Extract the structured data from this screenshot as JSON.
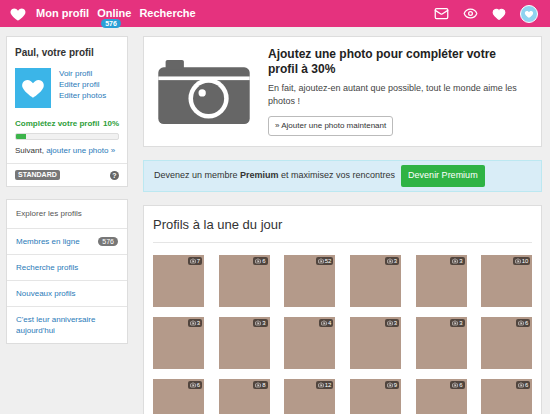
{
  "nav": [
    {
      "label": "Mon profil",
      "badge": ""
    },
    {
      "label": "Online",
      "badge": "576"
    },
    {
      "label": "Recherche",
      "badge": ""
    }
  ],
  "profile": {
    "title": "Paul, votre profil",
    "links": [
      "Voir profil",
      "Editer profil",
      "Editer photos"
    ],
    "progress": {
      "label": "Complétez votre profil",
      "reading": "10%",
      "level": 0.1
    },
    "next": {
      "prefix": "Suivant, ",
      "link": "ajouter une photo",
      "arrow": "»"
    },
    "membership": "STANDARD",
    "help": "?"
  },
  "explore": {
    "title": "Explorer les profils",
    "items": [
      {
        "label": "Membres en ligne",
        "badge": "576"
      },
      {
        "label": "Recherche profils",
        "badge": ""
      },
      {
        "label": "Nouveaux profils",
        "badge": ""
      },
      {
        "label": "C'est leur anniversaire aujourd'hui",
        "badge": ""
      }
    ]
  },
  "photo_prompt": {
    "title": "Ajoutez une photo pour compléter votre profil à 30%",
    "text": "En fait, ajoutez-en autant que possible, tout le monde aime les photos !",
    "button": {
      "arrow": "»",
      "label": "Ajouter une photo maintenant"
    }
  },
  "premium": {
    "before": "Devenez un membre ",
    "bold": "Premium",
    "after": " et maximisez vos rencontres",
    "button": "Devenir Premium"
  },
  "featured": {
    "title": "Profils à la une du jour",
    "photos": [
      {
        "count": "7"
      },
      {
        "count": "6"
      },
      {
        "count": "52"
      },
      {
        "count": "3"
      },
      {
        "count": "3"
      },
      {
        "count": "10"
      },
      {
        "count": "3"
      },
      {
        "count": "3"
      },
      {
        "count": "4"
      },
      {
        "count": "3"
      },
      {
        "count": "3"
      },
      {
        "count": "6"
      },
      {
        "count": "6"
      },
      {
        "count": "8"
      },
      {
        "count": "12"
      },
      {
        "count": "9"
      },
      {
        "count": "6"
      },
      {
        "count": "6"
      }
    ]
  }
}
